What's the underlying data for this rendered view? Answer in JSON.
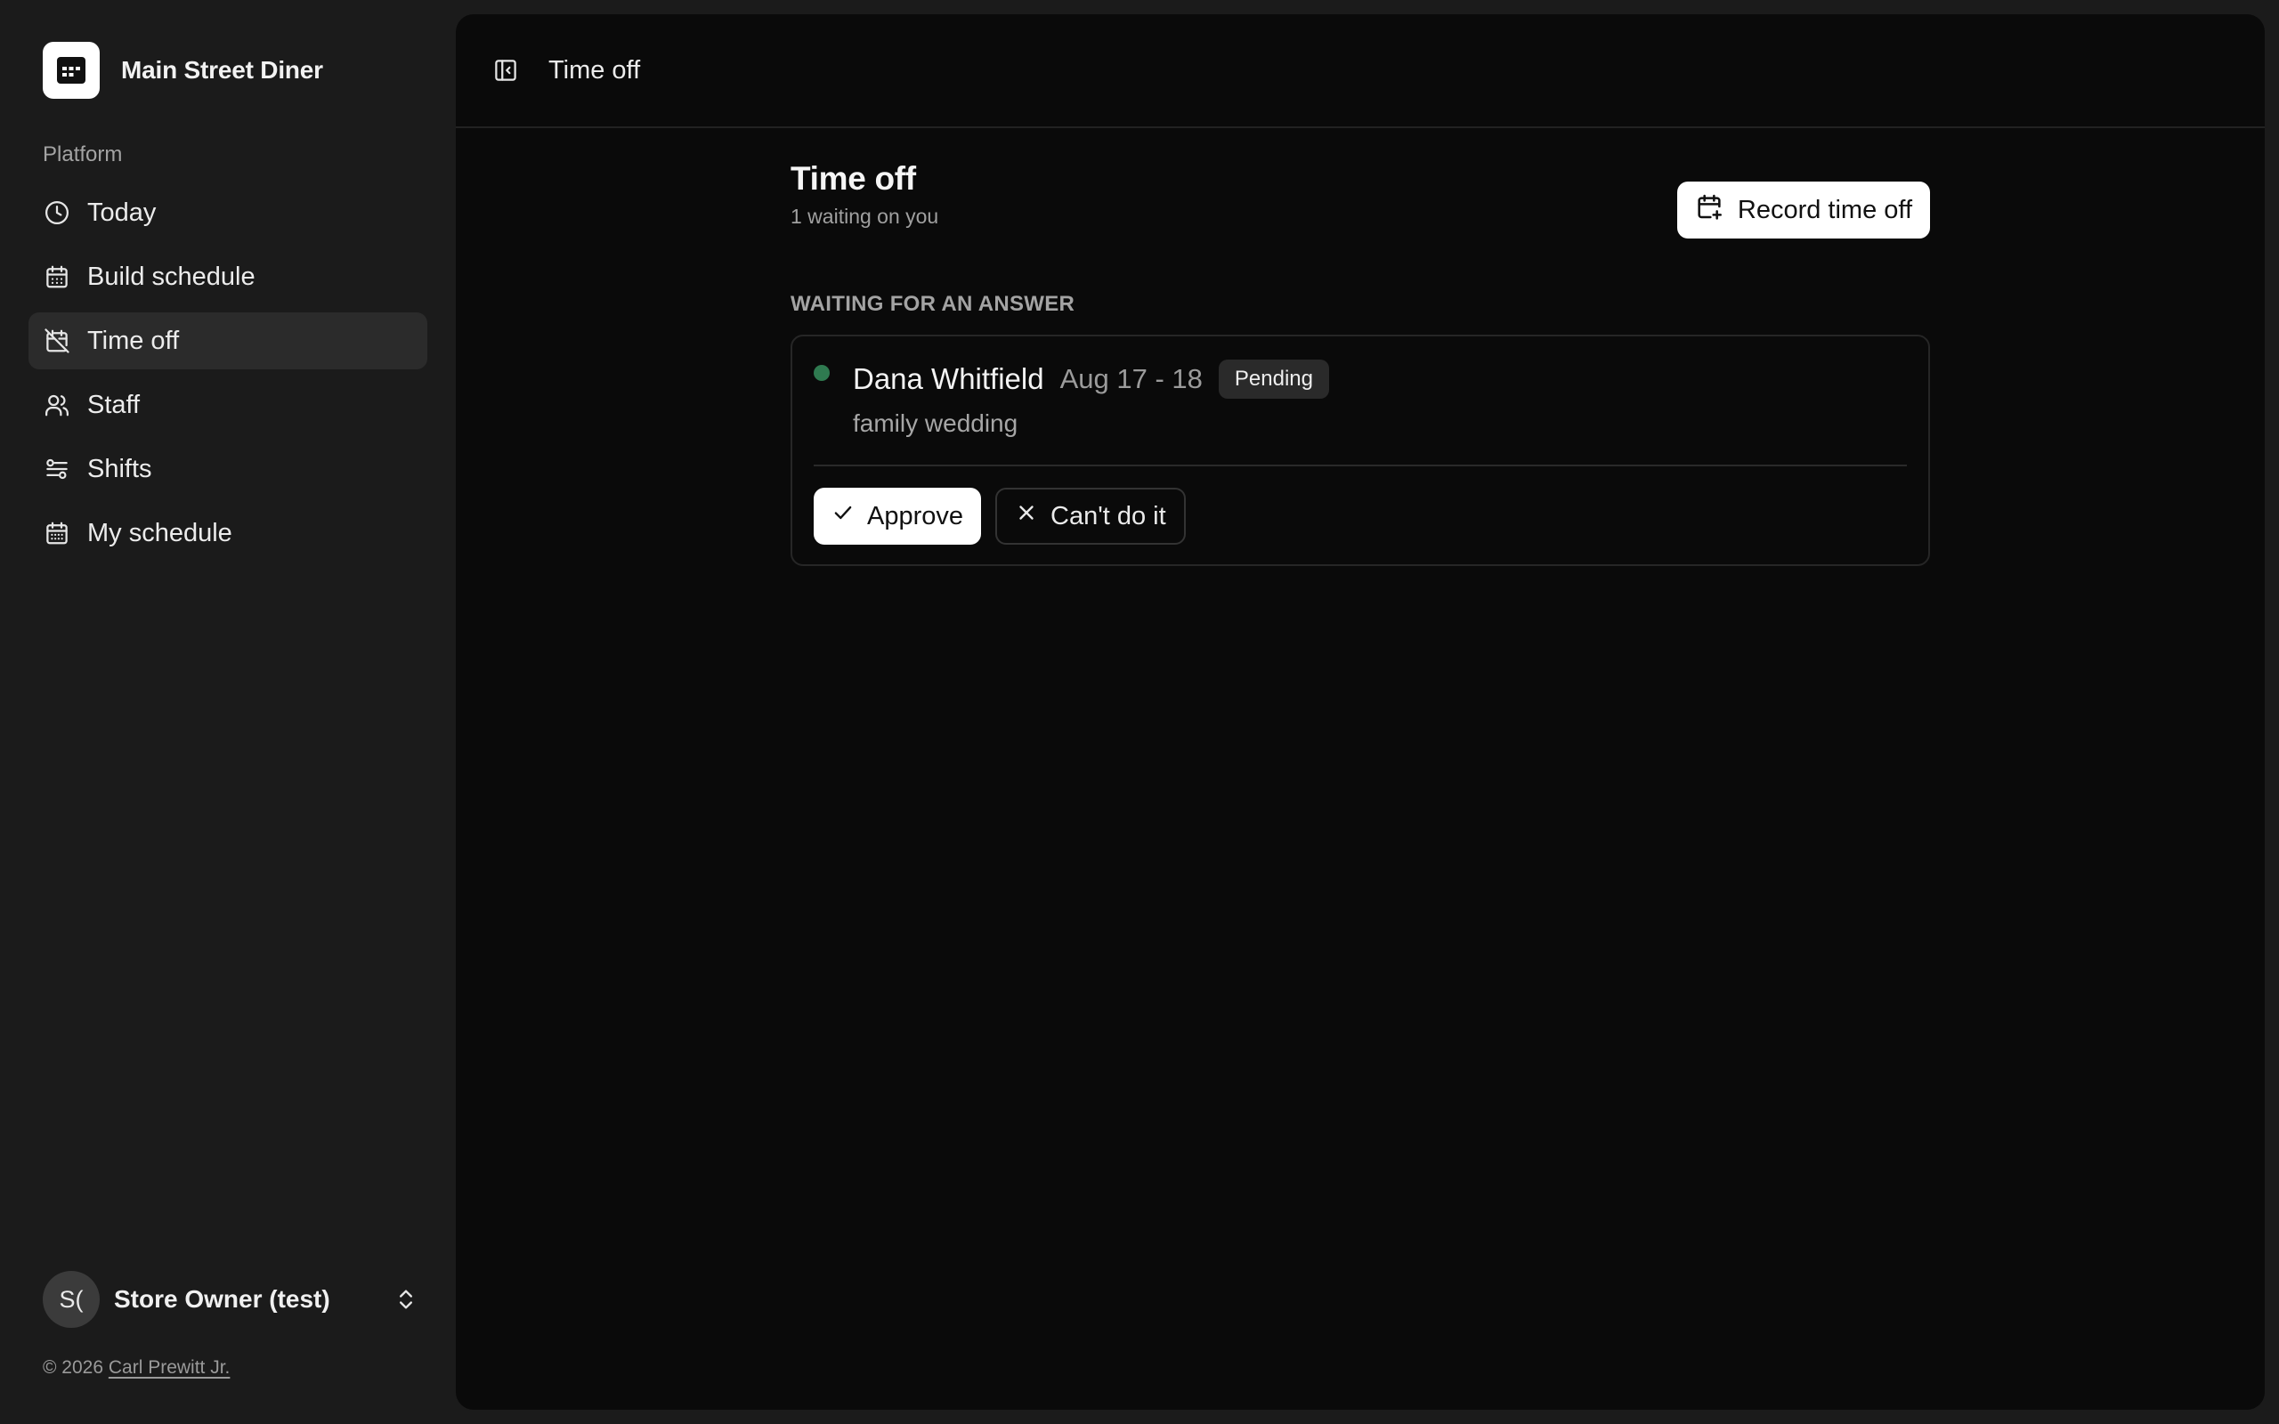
{
  "brand": {
    "name": "Main Street Diner",
    "logo_icon": "calendar-grid-icon"
  },
  "sidebar": {
    "group_label": "Platform",
    "items": [
      {
        "label": "Today",
        "icon": "clock-icon",
        "active": false
      },
      {
        "label": "Build schedule",
        "icon": "calendar-icon",
        "active": false
      },
      {
        "label": "Time off",
        "icon": "calendar-off-icon",
        "active": true
      },
      {
        "label": "Staff",
        "icon": "users-icon",
        "active": false
      },
      {
        "label": "Shifts",
        "icon": "sliders-icon",
        "active": false
      },
      {
        "label": "My schedule",
        "icon": "calendar-days-icon",
        "active": false
      }
    ],
    "user": {
      "initials": "S(",
      "name": "Store Owner (test)"
    },
    "footer": {
      "prefix": "© 2026",
      "author": "Carl Prewitt Jr."
    }
  },
  "topbar": {
    "title": "Time off",
    "toggle_icon": "panel-left-icon"
  },
  "page": {
    "title": "Time off",
    "subtitle": "1 waiting on you",
    "record_button": "Record time off",
    "section_label": "WAITING FOR AN ANSWER"
  },
  "requests": [
    {
      "name": "Dana Whitfield",
      "dates": "Aug 17 - 18",
      "status": "Pending",
      "reason": "family wedding",
      "approve_label": "Approve",
      "deny_label": "Can't do it"
    }
  ],
  "colors": {
    "sidebar_bg": "#1b1b1b",
    "main_bg": "#0a0a0a",
    "active_item_bg": "#2b2b2b",
    "status_dot": "#2f7a50"
  }
}
